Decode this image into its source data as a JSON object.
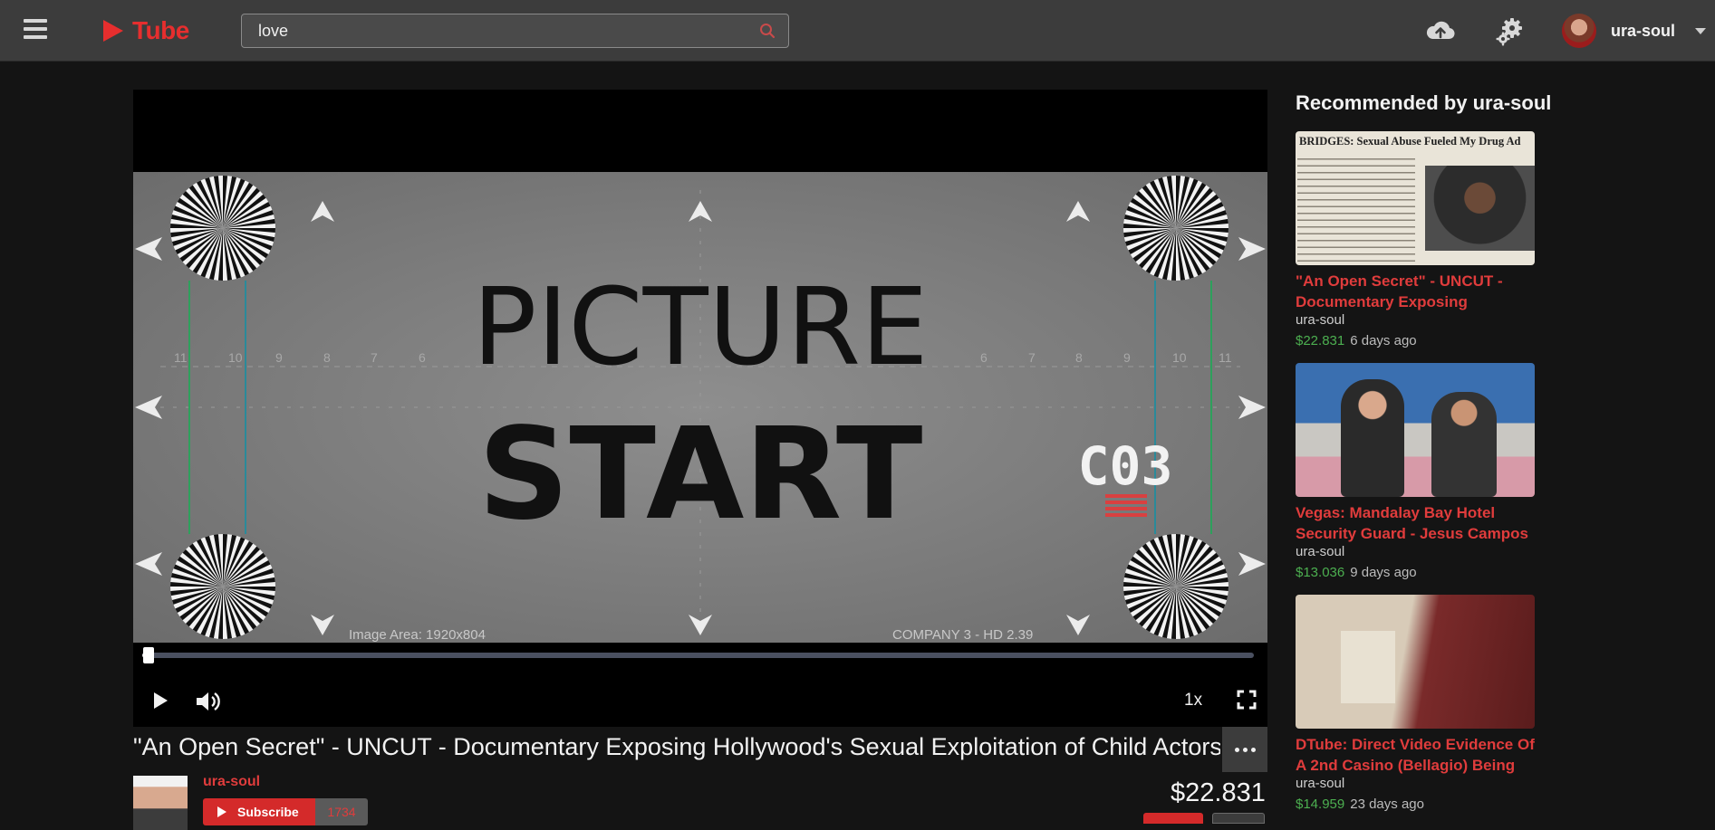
{
  "header": {
    "logo_text": "Tube",
    "search": {
      "value": "love",
      "placeholder": ""
    },
    "user": {
      "name": "ura-soul"
    }
  },
  "player": {
    "speed": "1x",
    "progress_fraction": 0.006,
    "frame_text": {
      "line1": "PICTURE",
      "line2": "START",
      "badge": "C03",
      "caption_left": "Image Area: 1920x804",
      "caption_right": "COMPANY 3 - HD 2.39",
      "scale_numbers": [
        "11",
        "10",
        "9",
        "8",
        "7",
        "6",
        "6",
        "7",
        "8",
        "9",
        "10",
        "11"
      ]
    }
  },
  "video": {
    "title": "\"An Open Secret\" - UNCUT - Documentary Exposing Hollywood's Sexual Exploitation of Child Actors",
    "channel": "ura-soul",
    "subscribe_label": "Subscribe",
    "subscriber_count": "1734",
    "payout": "$22.831"
  },
  "sidebar": {
    "heading": "Recommended by ura-soul",
    "items": [
      {
        "title": "\"An Open Secret\" - UNCUT - Documentary Exposing",
        "author": "ura-soul",
        "amount": "$22.831",
        "age": "6 days ago",
        "thumb_headline": "BRIDGES: Sexual Abuse Fueled My Drug Ad"
      },
      {
        "title": "Vegas: Mandalay Bay Hotel Security Guard - Jesus Campos -",
        "author": "ura-soul",
        "amount": "$13.036",
        "age": "9 days ago"
      },
      {
        "title": "DTube: Direct Video Evidence Of A 2nd Casino (Bellagio) Being",
        "author": "ura-soul",
        "amount": "$14.959",
        "age": "23 days ago"
      }
    ]
  },
  "colors": {
    "accent": "#e03c3c",
    "topbar": "#3c3c3c",
    "background": "#141414",
    "amount_green": "#4caf50"
  },
  "icons": [
    "menu-icon",
    "search-icon",
    "upload-cloud-icon",
    "gear-icon",
    "play-icon",
    "volume-icon",
    "fullscreen-icon",
    "more-icon",
    "caret-down-icon"
  ]
}
